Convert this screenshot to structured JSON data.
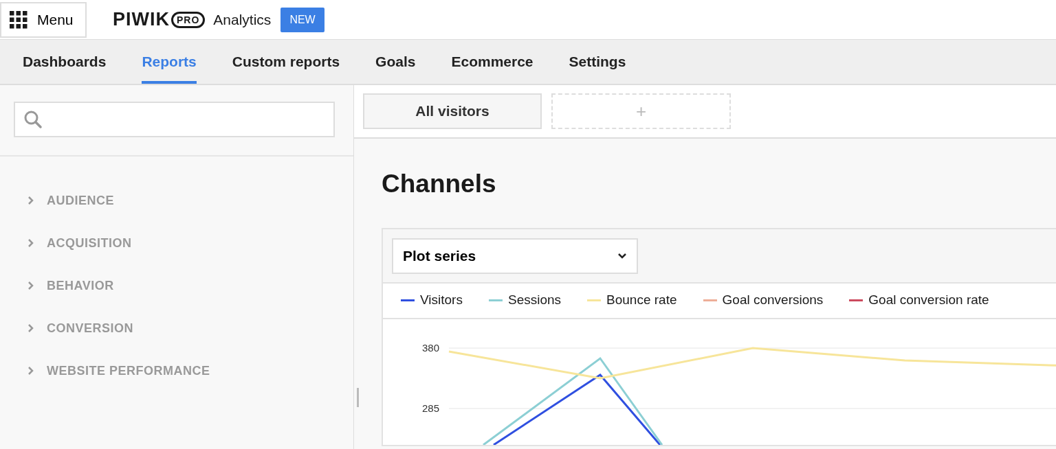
{
  "header": {
    "menu_label": "Menu",
    "logo_text": "PIWIK",
    "logo_badge": "PRO",
    "product": "Analytics",
    "badge": "NEW"
  },
  "tabs": [
    {
      "label": "Dashboards",
      "selected": false
    },
    {
      "label": "Reports",
      "selected": true
    },
    {
      "label": "Custom reports",
      "selected": false
    },
    {
      "label": "Goals",
      "selected": false
    },
    {
      "label": "Ecommerce",
      "selected": false
    },
    {
      "label": "Settings",
      "selected": false
    }
  ],
  "sidebar": {
    "items": [
      {
        "label": "AUDIENCE",
        "expanded": false
      },
      {
        "label": "ACQUISITION",
        "expanded": false
      },
      {
        "label": "BEHAVIOR",
        "expanded": false
      },
      {
        "label": "CONVERSION",
        "expanded": false
      },
      {
        "label": "WEBSITE PERFORMANCE",
        "expanded": false
      }
    ]
  },
  "segments": {
    "items": [
      "All visitors"
    ],
    "add_label": "+"
  },
  "report": {
    "title": "Channels",
    "plot_select": "Plot series",
    "legend": [
      {
        "name": "Visitors",
        "color": "#2f4fe0"
      },
      {
        "name": "Sessions",
        "color": "#8ccfd4"
      },
      {
        "name": "Bounce rate",
        "color": "#f7e59a"
      },
      {
        "name": "Goal conversions",
        "color": "#eeae98"
      },
      {
        "name": "Goal conversion rate",
        "color": "#cc4a5e"
      }
    ],
    "y_axis_labels": [
      "380",
      "285"
    ]
  }
}
